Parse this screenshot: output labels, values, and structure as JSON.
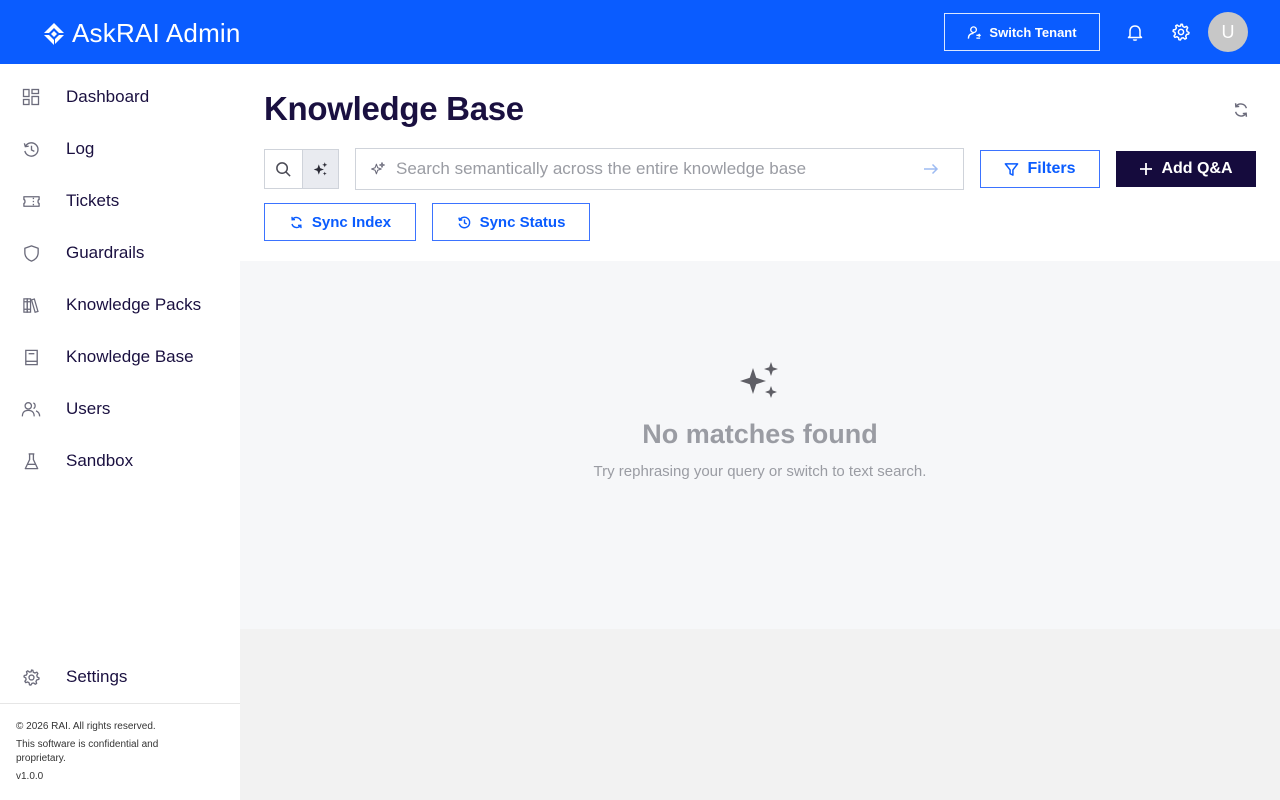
{
  "app": {
    "title": "AskRAI Admin",
    "brand_color": "#0a5cff",
    "dark_color": "#150b3d"
  },
  "header": {
    "switch_tenant_label": "Switch Tenant",
    "icons": [
      "bell-icon",
      "gear-icon"
    ],
    "avatar_initial": "U"
  },
  "sidebar": {
    "items": [
      {
        "label": "Dashboard",
        "icon": "dashboard-icon"
      },
      {
        "label": "Log",
        "icon": "history-icon"
      },
      {
        "label": "Tickets",
        "icon": "ticket-icon"
      },
      {
        "label": "Guardrails",
        "icon": "shield-icon"
      },
      {
        "label": "Knowledge Packs",
        "icon": "books-icon"
      },
      {
        "label": "Knowledge Base",
        "icon": "book-icon"
      },
      {
        "label": "Users",
        "icon": "users-icon"
      },
      {
        "label": "Sandbox",
        "icon": "flask-icon"
      }
    ],
    "settings_label": "Settings",
    "footer": {
      "copyright": "© 2026 RAI. All rights reserved.",
      "notice": "This software is confidential and proprietary.",
      "version": "v1.0.0"
    }
  },
  "main": {
    "title": "Knowledge Base",
    "search": {
      "mode": "semantic",
      "placeholder": "Search semantically across the entire knowledge base",
      "value": ""
    },
    "filters_label": "Filters",
    "add_label": "Add Q&A",
    "sync_index_label": "Sync Index",
    "sync_status_label": "Sync Status",
    "empty": {
      "title": "No matches found",
      "subtitle": "Try rephrasing your query or switch to text search."
    }
  }
}
